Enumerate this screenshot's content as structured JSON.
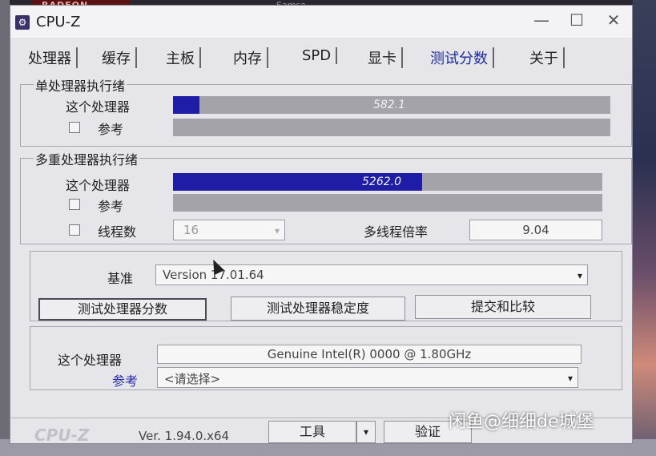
{
  "background": {
    "radeon_label": "RADEON",
    "top_text": "Samsa"
  },
  "window": {
    "title": "CPU-Z",
    "icon": "cpu-z-icon",
    "controls": {
      "minimize": "—",
      "maximize": "☐",
      "close": "✕"
    }
  },
  "tabs": [
    {
      "label": "处理器"
    },
    {
      "label": "缓存"
    },
    {
      "label": "主板"
    },
    {
      "label": "内存"
    },
    {
      "label": "SPD"
    },
    {
      "label": "显卡"
    },
    {
      "label": "测试分数",
      "active": true
    },
    {
      "label": "关于"
    }
  ],
  "single_thread": {
    "group_title": "单处理器执行绪",
    "this_cpu_label": "这个处理器",
    "this_cpu_value": "582.1",
    "this_cpu_fraction": 0.06,
    "reference_label": "参考",
    "reference_checked": false
  },
  "multi_thread": {
    "group_title": "多重处理器执行绪",
    "this_cpu_label": "这个处理器",
    "this_cpu_value": "5262.0",
    "this_cpu_fraction": 0.58,
    "reference_label": "参考",
    "reference_checked": false,
    "threads_label": "线程数",
    "threads_value": "16",
    "ratio_label": "多线程倍率",
    "ratio_value": "9.04"
  },
  "benchmark": {
    "label": "基准",
    "value": "Version 17.01.64"
  },
  "buttons": {
    "bench_cpu": "测试处理器分数",
    "stress_cpu": "测试处理器稳定度",
    "submit": "提交和比较"
  },
  "processor_info": {
    "this_label": "这个处理器",
    "this_value": "Genuine Intel(R) 0000 @ 1.80GHz",
    "reference_label": "参考",
    "reference_value": "<请选择>"
  },
  "footer": {
    "logo": "CPU-Z",
    "version": "Ver. 1.94.0.x64",
    "tools_label": "工具",
    "validate_label": "验证"
  },
  "watermark": "闲鱼@细细de城堡"
}
